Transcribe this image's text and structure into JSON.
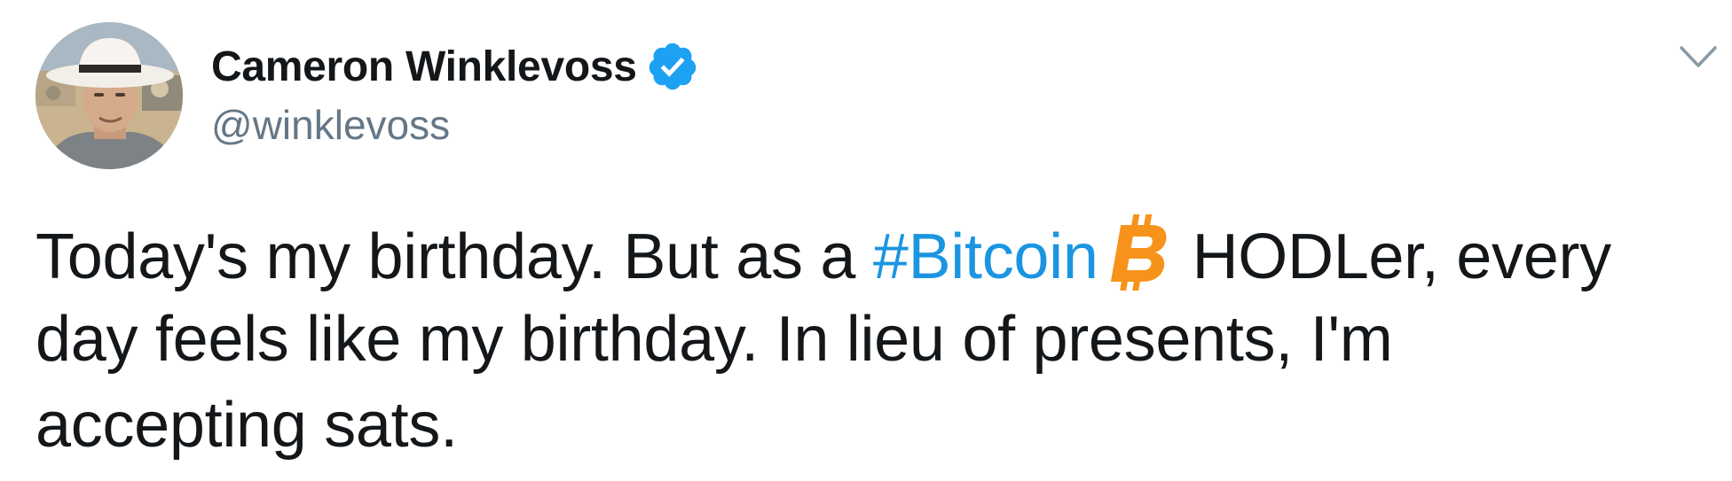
{
  "author": {
    "display_name": "Cameron Winklevoss",
    "handle": "@winklevoss",
    "verified": true,
    "avatar": "profile-photo-man-in-white-hat"
  },
  "menu": {
    "icon": "chevron-down-icon"
  },
  "tweet": {
    "line1_before": "Today's my birthday. But as a ",
    "hashtag": "#Bitcoin",
    "emoji": "bitcoin-icon",
    "line1_after": "HODLer, every",
    "line2": "day feels like my birthday. In lieu of presents, I'm",
    "line3": "accepting sats."
  },
  "colors": {
    "text": "#14171a",
    "handle": "#657786",
    "link": "#1b95e0",
    "verified": "#1da1f2",
    "bitcoin": "#f7931a",
    "chevron": "#8899a6"
  }
}
